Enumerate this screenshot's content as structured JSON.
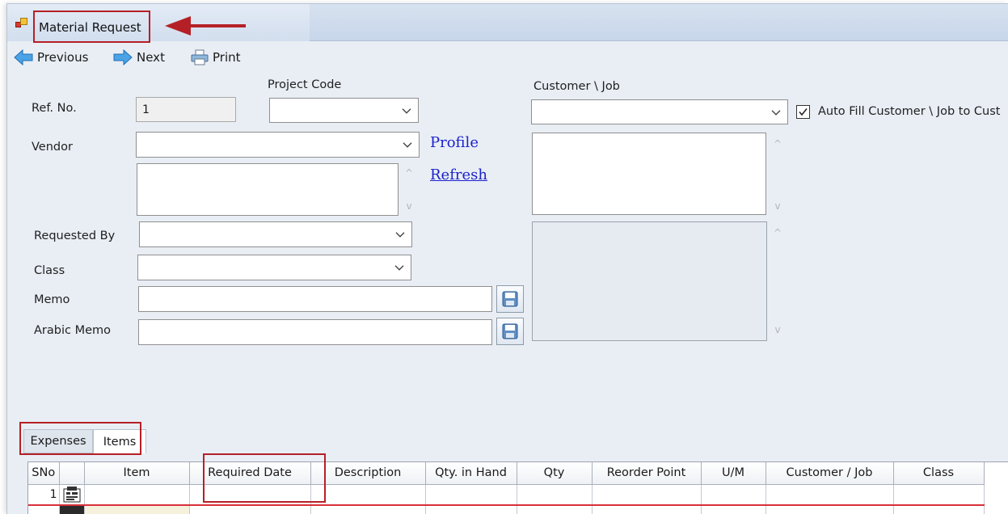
{
  "window": {
    "title": "Material Request"
  },
  "toolbar": {
    "previous": "Previous",
    "next": "Next",
    "print": "Print"
  },
  "form": {
    "ref_no_label": "Ref. No.",
    "ref_no_value": "1",
    "project_code_label": "Project Code",
    "customer_job_label": "Customer \\ Job",
    "auto_fill_label": "Auto Fill Customer \\ Job to Cust",
    "auto_fill_checked": true,
    "vendor_label": "Vendor",
    "profile_link": "Profile",
    "refresh_link": "Refresh",
    "requested_by_label": "Requested By",
    "class_label": "Class",
    "memo_label": "Memo",
    "arabic_memo_label": "Arabic Memo"
  },
  "tabs": [
    {
      "label": "Expenses",
      "active": false
    },
    {
      "label": "Items",
      "active": true
    }
  ],
  "grid": {
    "columns": [
      "SNo",
      "",
      "Item",
      "Required Date",
      "Description",
      "Qty. in Hand",
      "Qty",
      "Reorder Point",
      "U/M",
      "Customer / Job",
      "Class"
    ],
    "rows": [
      {
        "sno": "1"
      }
    ]
  },
  "colors": {
    "highlight": "#b52026",
    "link": "#1b22c9",
    "window_bg": "#e9eef5"
  }
}
